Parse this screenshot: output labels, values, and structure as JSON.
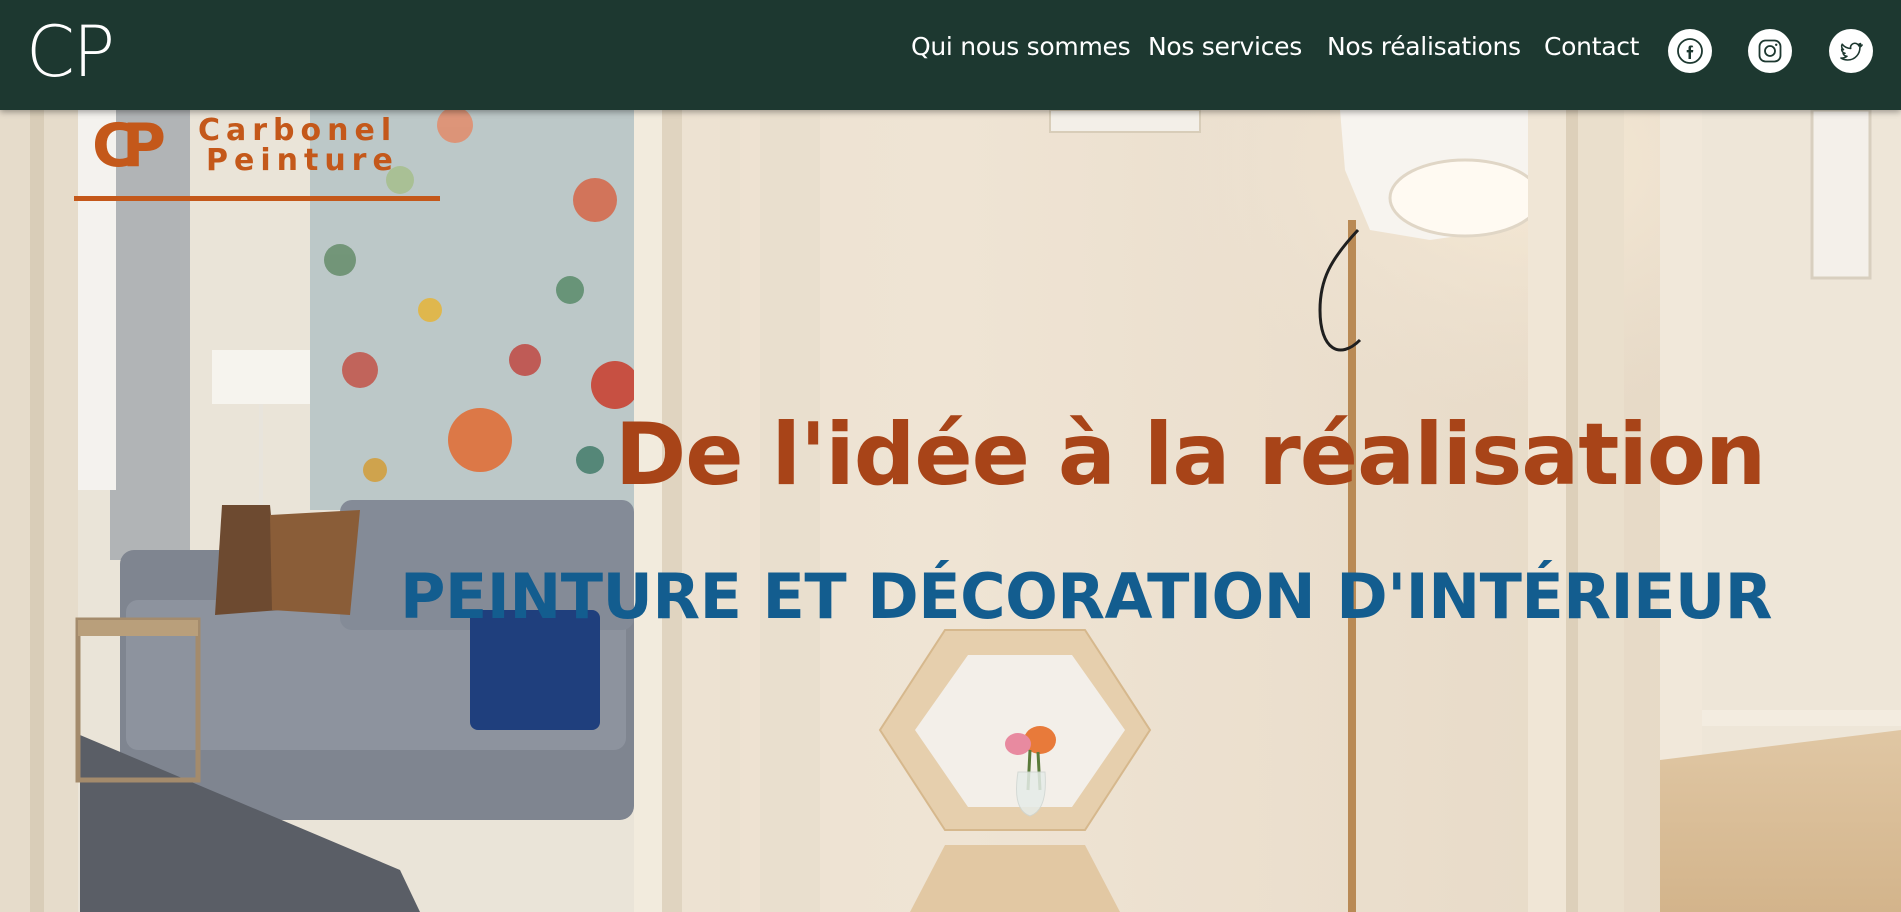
{
  "header": {
    "logo": "CP",
    "nav": [
      {
        "label": "Qui nous sommes"
      },
      {
        "label": "Nos services"
      },
      {
        "label": "Nos réalisations"
      },
      {
        "label": "Contact"
      }
    ],
    "social": [
      {
        "icon": "facebook-icon"
      },
      {
        "icon": "instagram-icon"
      },
      {
        "icon": "twitter-icon"
      }
    ]
  },
  "hero": {
    "brand": {
      "mark": "CP",
      "line1": "Carbonel",
      "line2": "Peinture"
    },
    "headline": "De l'idée à la réalisation",
    "subheadline": "PEINTURE ET DÉCORATION D'INTÉRIEUR"
  },
  "colors": {
    "nav_bg": "#1d3830",
    "headline": "#a84418",
    "subheadline": "#135d8f",
    "brand": "#c4581a"
  }
}
